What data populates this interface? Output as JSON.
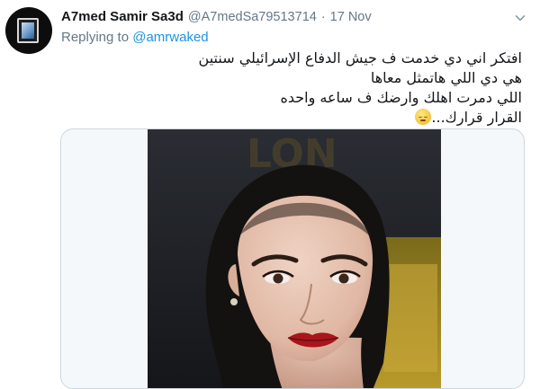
{
  "tweet": {
    "author": {
      "display_name": "A7med Samir Sa3d",
      "handle": "@A7medSa79513714",
      "avatar_icon": "framed-picture-avatar"
    },
    "separator": "·",
    "date": "17 Nov",
    "reply": {
      "prefix": "Replying to",
      "user": "@amrwaked"
    },
    "text_lines": [
      "افتكر اني دي خدمت ف جيش الدفاع الإسرائيلي سنتين",
      "هي دي اللي هاتمثل معاها",
      "اللي دمرت اهلك وارضك ف ساعه واحده",
      "القرار قرارك..."
    ],
    "emoji_icon": "pensive-face-emoji",
    "menu_icon": "chevron-down-icon",
    "media": {
      "type": "photo",
      "background_text_fragment": "LON"
    }
  },
  "colors": {
    "link": "#1b95e0",
    "secondary_text": "#657786",
    "primary_text": "#14171a",
    "card_border": "#ccd6dd"
  }
}
